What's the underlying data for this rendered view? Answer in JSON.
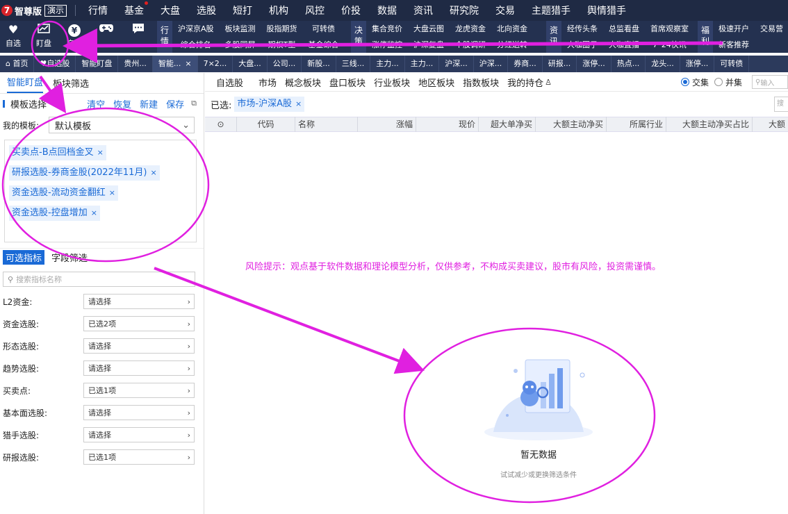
{
  "app": {
    "brand": "智尊版",
    "demo_badge": "演示"
  },
  "menubar": {
    "items": [
      "行情",
      "基金",
      "大盘",
      "选股",
      "短打",
      "机构",
      "风控",
      "价投",
      "数据",
      "资讯",
      "研究院",
      "交易",
      "主题猎手",
      "舆情猎手"
    ]
  },
  "ribbon": {
    "buttons": [
      {
        "label": "自选",
        "icon": "heart-icon"
      },
      {
        "label": "盯盘",
        "icon": "chart-monitor-icon"
      },
      {
        "label": "交易",
        "icon": "yen-icon"
      },
      {
        "label": "",
        "icon": "gamepad-icon"
      },
      {
        "label": "",
        "icon": "chat-icon"
      }
    ],
    "groups": [
      {
        "title": "行情",
        "items": [
          "沪深京A股",
          "综合排名",
          "板块监测",
          "多股同屏",
          "股指期货",
          "期权T型",
          "可转债",
          "基金综合"
        ]
      },
      {
        "title": "决策",
        "items": [
          "集合竞价",
          "涨停监控",
          "大盘云图",
          "沪深复盘",
          "龙虎资金",
          "个股调研",
          "北向资金",
          "分红送转"
        ]
      },
      {
        "title": "资讯",
        "items": [
          "经传头条",
          "大咖圈子",
          "总监看盘",
          "大咖直播",
          "首席观察室",
          "7*24快讯"
        ]
      },
      {
        "title": "福利",
        "items": [
          "极速开户",
          "新客推荐",
          "交易营"
        ]
      }
    ]
  },
  "tabstrip": {
    "tabs": [
      "首页",
      "自选股",
      "智能盯盘",
      "贵州...",
      "智能...",
      "7×2...",
      "大盘...",
      "公司...",
      "新股...",
      "三线...",
      "主力...",
      "主力...",
      "沪深...",
      "沪深...",
      "券商...",
      "研报...",
      "涨停...",
      "热点...",
      "龙头...",
      "涨停...",
      "可转债"
    ],
    "active_index": 4,
    "close_glyph": "×"
  },
  "left": {
    "subtabs": [
      "智能盯盘",
      "板块筛选"
    ],
    "template_header": {
      "title": "模板选择",
      "actions": [
        "清空",
        "恢复",
        "新建",
        "保存"
      ]
    },
    "my_template": {
      "label": "我的模板:",
      "value": "默认模板"
    },
    "chips": [
      "买卖点-B点回档金叉",
      "研报选股-券商金股(2022年11月)",
      "资金选股-流动资金翻红",
      "资金选股-控盘增加"
    ],
    "indicator_tabs": [
      "可选指标",
      "字段筛选"
    ],
    "search_placeholder": "搜索指标名称",
    "filters": [
      {
        "label": "L2资金:",
        "value": "请选择"
      },
      {
        "label": "资金选股:",
        "value": "已选2项"
      },
      {
        "label": "形态选股:",
        "value": "请选择"
      },
      {
        "label": "趋势选股:",
        "value": "请选择"
      },
      {
        "label": "买卖点:",
        "value": "已选1项"
      },
      {
        "label": "基本面选股:",
        "value": "请选择"
      },
      {
        "label": "猎手选股:",
        "value": "请选择"
      },
      {
        "label": "研报选股:",
        "value": "已选1项"
      }
    ]
  },
  "right": {
    "categories": [
      "自选股",
      "市场",
      "概念板块",
      "盘口板块",
      "行业板块",
      "地区板块",
      "指数板块",
      "我的持仓"
    ],
    "radios": [
      {
        "label": "交集",
        "checked": true
      },
      {
        "label": "并集",
        "checked": false
      }
    ],
    "search_placeholder": "输入",
    "selected_label": "已选:",
    "selected_chip": "市场-沪深A股",
    "search2_placeholder": "搜",
    "columns": [
      "代码",
      "名称",
      "涨幅",
      "现价",
      "超大单净买",
      "大额主动净买",
      "所属行业",
      "大额主动净买占比",
      "大额"
    ],
    "risk_notice": "风险提示：观点基于软件数据和理论模型分析，仅供参考，不构成买卖建议，股市有风险，投资需谨慎。",
    "empty": {
      "title": "暂无数据",
      "subtitle": "试试减少或更换筛选条件"
    }
  },
  "colors": {
    "accent": "#1a6ad6",
    "annotation": "#e020e0",
    "menubar_bg": "#1f2a44"
  }
}
